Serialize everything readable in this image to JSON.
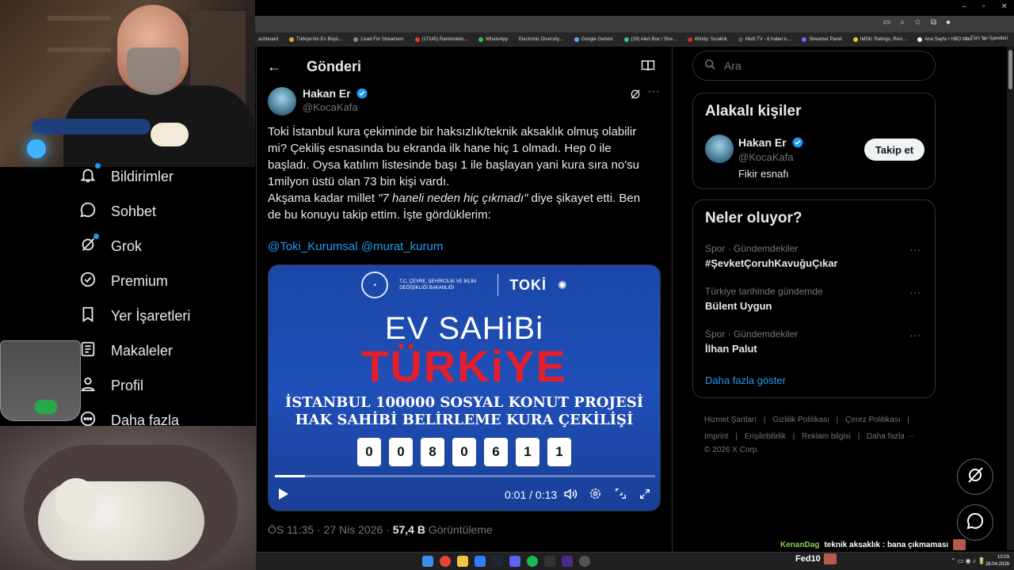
{
  "browser": {
    "bookmarks": [
      "ashboard",
      "Türkiye'nin En Büyü...",
      "Livad For Streamers",
      "(17145) Rammstein...",
      "WhatsApp",
      "Electronic Diversity...",
      "Google Gemini",
      "(19) Alert Box / Stre...",
      "Windy: Sıcaklık",
      "Multi TV - 6 haber k...",
      "Streamer Panel",
      "IMDb: Ratings, Revi...",
      "Ana Sayfa • HBO Max"
    ],
    "bookmarks_more": "»",
    "all_bookmarks": "Tüm Yer İşaretleri"
  },
  "nav": {
    "items": [
      {
        "label": "Bildirimler",
        "icon": "bell-icon"
      },
      {
        "label": "Sohbet",
        "icon": "chat-icon"
      },
      {
        "label": "Grok",
        "icon": "grok-icon"
      },
      {
        "label": "Premium",
        "icon": "verified-icon"
      },
      {
        "label": "Yer İşaretleri",
        "icon": "bookmark-icon"
      },
      {
        "label": "Makaleler",
        "icon": "article-icon"
      },
      {
        "label": "Profil",
        "icon": "person-icon"
      },
      {
        "label": "Daha fazla",
        "icon": "more-circle-icon"
      }
    ]
  },
  "post": {
    "header_title": "Gönderi",
    "author_name": "Hakan Er",
    "author_handle": "@KocaKafa",
    "text_line1": "Toki İstanbul kura çekiminde bir haksızlık/teknik aksaklık olmuş olabilir mi? Çekiliş esnasında bu ekranda ilk hane hiç 1 olmadı. Hep 0 ile başladı. Oysa katılım listesinde başı 1 ile başlayan yani kura sıra no'su 1milyon üstü olan 73 bin kişi vardı.",
    "text_line2_a": "Akşama kadar millet ",
    "text_line2_quote": "\"7 haneli neden hiç çıkmadı\"",
    "text_line2_b": " diye şikayet etti. Ben de bu konuyu takip ettim. İşte gördüklerim:",
    "mentions": "@Toki_Kurumsal @murat_kurum",
    "video": {
      "ministry": "T.C. ÇEVRE, ŞEHİRCİLİK VE İKLİM DEĞİŞİKLİĞİ BAKANLIĞI",
      "logo": "TOKİ",
      "title1": "EV SAHiBi",
      "title2": "TÜRKiYE",
      "subtitle1": "İSTANBUL 100000 SOSYAL KONUT PROJESİ",
      "subtitle2": "HAK SAHİBİ BELİRLEME KURA ÇEKİLİŞİ",
      "digits": [
        "0",
        "0",
        "8",
        "0",
        "6",
        "1",
        "1"
      ],
      "time": "0:01 / 0:13",
      "progress": 0.08
    },
    "meta_time": "ÖS 11:35 · 27 Nis 2026 · ",
    "meta_views": "57,4 B",
    "meta_views_label": " Görüntüleme"
  },
  "sidebar": {
    "search_placeholder": "Ara",
    "related_title": "Alakalı kişiler",
    "related_name": "Hakan Er",
    "related_handle": "@KocaKafa",
    "related_bio": "Fikir esnafı",
    "follow_label": "Takip et",
    "trending_title": "Neler oluyor?",
    "trends": [
      {
        "context": "Spor · Gündemdekiler",
        "title": "#ŞevketÇoruhKavuğuÇıkar"
      },
      {
        "context": "Türkiye tarihinde gündemde",
        "title": "Bülent Uygun"
      },
      {
        "context": "Spor · Gündemdekiler",
        "title": "İlhan Palut"
      }
    ],
    "show_more": "Daha fazla göster",
    "footer_links": [
      "Hizmet Şartları",
      "|",
      "Gizlilik Politikası",
      "|",
      "Çerez Politikası",
      "|",
      "Imprint",
      "|",
      "Erişilebilirlik",
      "|",
      "Reklam bilgisi",
      "|",
      "Daha fazla ···"
    ],
    "copyright": "© 2026 X Corp."
  },
  "chat": {
    "user1": "KenanDag",
    "msg1": "teknik aksaklık : bana çıkmaması",
    "user2": "Fed10"
  },
  "taskbar": {
    "clock_time": "10:03",
    "clock_date": "28.04.2026"
  },
  "colors": {
    "accent": "#1d9bf0",
    "title_red": "#e31e2d",
    "video_blue": "#1f4fb8"
  }
}
